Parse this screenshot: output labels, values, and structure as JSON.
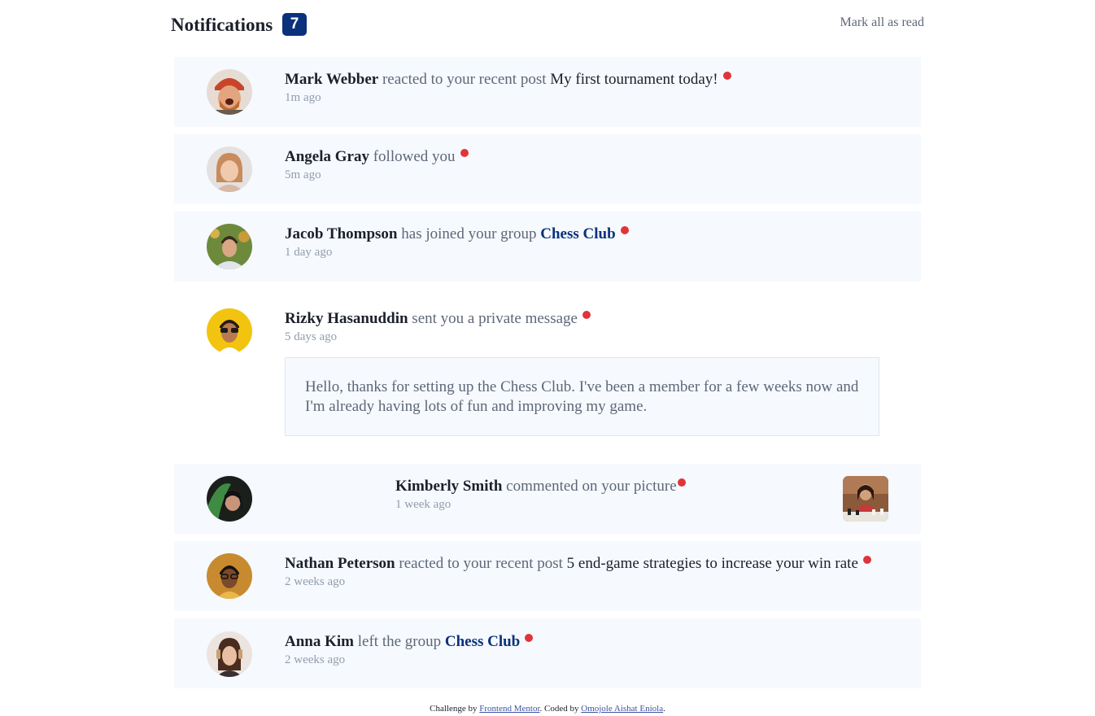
{
  "header": {
    "title": "Notifications",
    "unread_count": "7",
    "mark_all_label": "Mark all as read"
  },
  "notifications": [
    {
      "name": "Mark Webber",
      "action": " reacted to your recent post ",
      "target": "My first tournament today!",
      "time": "1m ago",
      "unread": true
    },
    {
      "name": "Angela Gray",
      "action": " followed you",
      "time": "5m ago",
      "unread": true
    },
    {
      "name": "Jacob Thompson",
      "action": " has joined your group ",
      "target": "Chess Club",
      "time": "1 day ago",
      "unread": true
    },
    {
      "name": "Rizky Hasanuddin",
      "action": " sent you a private message",
      "time": "5 days ago",
      "message": "Hello, thanks for setting up the Chess Club. I've been a member for a few weeks now and I'm already having lots of fun and improving my game.",
      "unread": true
    },
    {
      "name": "Kimberly Smith",
      "action": " commented on your picture",
      "time": "1 week ago",
      "unread": true
    },
    {
      "name": "Nathan Peterson",
      "action": " reacted to your recent post ",
      "target": "5 end-game strategies to increase your win rate",
      "time": "2 weeks ago",
      "unread": true
    },
    {
      "name": "Anna Kim",
      "action": " left the group ",
      "target": "Chess Club",
      "time": "2 weeks ago",
      "unread": true
    }
  ],
  "footer": {
    "prefix": "Challenge by ",
    "link1": "Frontend Mentor",
    "middle": ". Coded by ",
    "link2": "Omojole Aishat Eniola",
    "suffix": "."
  },
  "colors": {
    "accent": "#0a317b",
    "unread_dot": "#e0343b",
    "card_bg": "#f6f9fd",
    "text_dark": "#1c202b",
    "text_muted": "#5e6778",
    "text_light": "#939cad"
  }
}
